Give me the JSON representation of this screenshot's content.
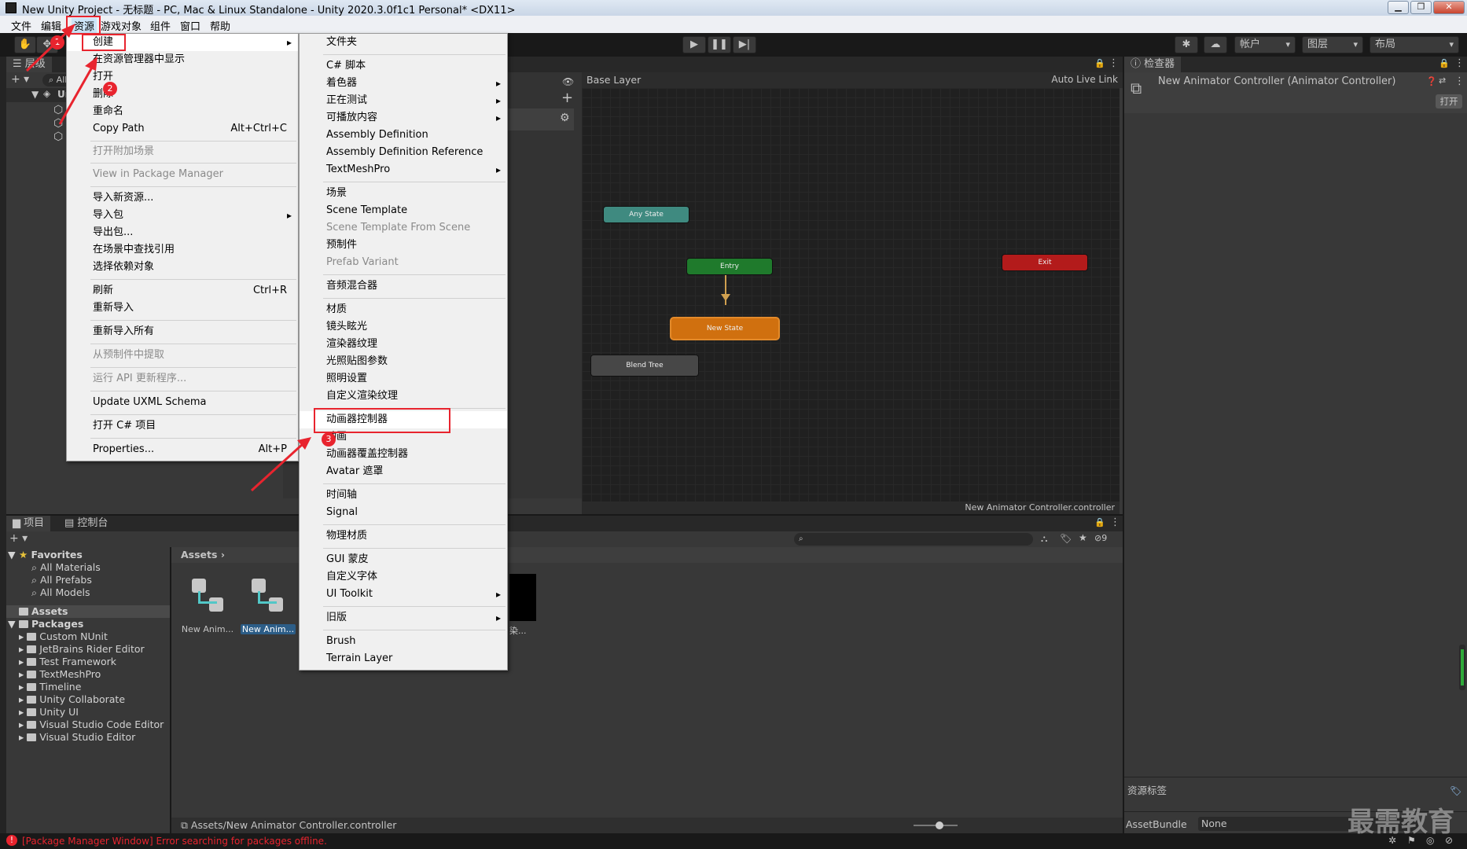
{
  "window": {
    "title": "New Unity Project - 无标题 - PC, Mac & Linux Standalone - Unity 2020.3.0f1c1 Personal* <DX11>"
  },
  "menubar": [
    "文件",
    "编辑",
    "资源",
    "游戏对象",
    "组件",
    "窗口",
    "帮助"
  ],
  "toolbar": {
    "account": "帐户",
    "layers": "图层",
    "layout": "布局"
  },
  "hierarchy": {
    "tab": "层级",
    "search_placeholder": "All",
    "scene": "Ur"
  },
  "animator": {
    "layer": "Base Layer",
    "auto_live_link": "Auto Live Link",
    "nodes": {
      "any_state": "Any State",
      "entry": "Entry",
      "exit": "Exit",
      "new_state": "New State",
      "blend_tree": "Blend Tree"
    },
    "footer_path": "New Animator Controller.controller"
  },
  "inspector": {
    "tab": "检查器",
    "title": "New Animator Controller (Animator Controller)",
    "open_button": "打开",
    "asset_labels": "资源标签",
    "asset_bundle_label": "AssetBundle",
    "asset_bundle_value": "None"
  },
  "asset_menu": [
    {
      "label": "创建",
      "submenu": true
    },
    {
      "label": "在资源管理器中显示"
    },
    {
      "label": "打开"
    },
    {
      "label": "删除"
    },
    {
      "label": "重命名"
    },
    {
      "label": "Copy Path",
      "shortcut": "Alt+Ctrl+C"
    },
    {
      "label": "打开附加场景",
      "disabled": true
    },
    {
      "label": "View in Package Manager",
      "disabled": true
    },
    {
      "label": "导入新资源..."
    },
    {
      "label": "导入包",
      "submenu": true
    },
    {
      "label": "导出包..."
    },
    {
      "label": "在场景中查找引用"
    },
    {
      "label": "选择依赖对象"
    },
    {
      "label": "刷新",
      "shortcut": "Ctrl+R"
    },
    {
      "label": "重新导入"
    },
    {
      "label": "重新导入所有"
    },
    {
      "label": "从预制件中提取",
      "disabled": true
    },
    {
      "label": "运行 API 更新程序...",
      "disabled": true
    },
    {
      "label": "Update UXML Schema"
    },
    {
      "label": "打开 C# 项目"
    },
    {
      "label": "Properties...",
      "shortcut": "Alt+P"
    }
  ],
  "create_menu": [
    {
      "label": "文件夹"
    },
    {
      "label": "C# 脚本"
    },
    {
      "label": "着色器",
      "submenu": true
    },
    {
      "label": "正在测试",
      "submenu": true
    },
    {
      "label": "可播放内容",
      "submenu": true
    },
    {
      "label": "Assembly Definition"
    },
    {
      "label": "Assembly Definition Reference"
    },
    {
      "label": "TextMeshPro",
      "submenu": true
    },
    {
      "label": "场景"
    },
    {
      "label": "Scene Template"
    },
    {
      "label": "Scene Template From Scene",
      "disabled": true
    },
    {
      "label": "预制件"
    },
    {
      "label": "Prefab Variant",
      "disabled": true
    },
    {
      "label": "音频混合器"
    },
    {
      "label": "材质"
    },
    {
      "label": "镜头眩光"
    },
    {
      "label": "渲染器纹理"
    },
    {
      "label": "光照贴图参数"
    },
    {
      "label": "照明设置"
    },
    {
      "label": "自定义渲染纹理"
    },
    {
      "label": "动画器控制器",
      "highlighted": true
    },
    {
      "label": "动画"
    },
    {
      "label": "动画器覆盖控制器"
    },
    {
      "label": "Avatar 遮罩"
    },
    {
      "label": "时间轴"
    },
    {
      "label": "Signal"
    },
    {
      "label": "物理材质"
    },
    {
      "label": "GUI 蒙皮"
    },
    {
      "label": "自定义字体"
    },
    {
      "label": "UI Toolkit",
      "submenu": true
    },
    {
      "label": "旧版",
      "submenu": true
    },
    {
      "label": "Brush"
    },
    {
      "label": "Terrain Layer"
    }
  ],
  "annotations": {
    "badge1": "1",
    "badge2": "2",
    "badge3": "3"
  },
  "project": {
    "tab_project": "项目",
    "tab_console": "控制台",
    "favorites": "Favorites",
    "fav_items": [
      "All Materials",
      "All Prefabs",
      "All Models"
    ],
    "assets": "Assets",
    "packages": "Packages",
    "package_items": [
      "Custom NUnit",
      "JetBrains Rider Editor",
      "Test Framework",
      "TextMeshPro",
      "Timeline",
      "Unity Collaborate",
      "Unity UI",
      "Visual Studio Code Editor",
      "Visual Studio Editor"
    ],
    "breadcrumb": "Assets",
    "asset1": "New Anim...",
    "asset2": "New Anim...",
    "asset3": "染...",
    "footer_path": "Assets/New Animator Controller.controller",
    "hidden_count": "9"
  },
  "status": {
    "error": "[Package Manager Window] Error searching for packages offline."
  },
  "watermark": "最需教育",
  "colors": {
    "any_state": "#3f8a80",
    "entry": "#1f7a2c",
    "exit": "#b31b1b",
    "new_state": "#d0700f",
    "blend_tree": "#474747",
    "annotation": "#e8242e",
    "error": "#e8242e"
  }
}
